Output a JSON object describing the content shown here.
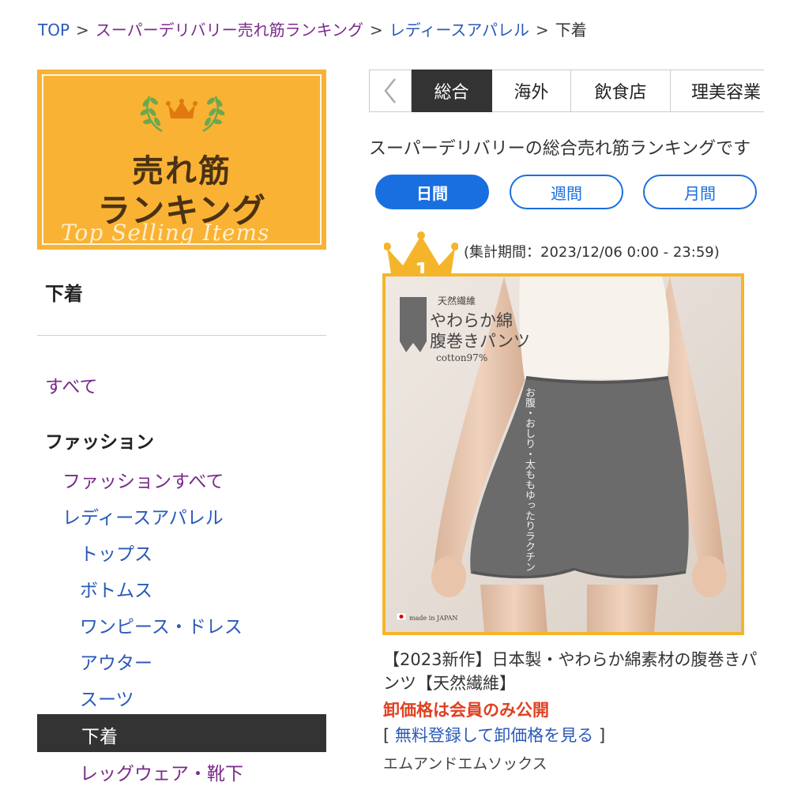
{
  "breadcrumb": {
    "top": "TOP",
    "ranking": "スーパーデリバリー売れ筋ランキング",
    "category": "レディースアパレル",
    "current": "下着",
    "separator": ">"
  },
  "banner": {
    "line1": "売れ筋",
    "line2": "ランキング",
    "subtitle": "Top Selling Items",
    "colors": {
      "background": "#f9b233",
      "crown": "#e07a10",
      "laurel": "#6aa84f"
    }
  },
  "sidebar": {
    "heading": "下着",
    "all_link": "すべて",
    "category_heading": "ファッション",
    "items": [
      {
        "label": "ファッションすべて",
        "level": 1,
        "visited": true
      },
      {
        "label": "レディースアパレル",
        "level": 1,
        "visited": false
      },
      {
        "label": "トップス",
        "level": 2,
        "visited": false
      },
      {
        "label": "ボトムス",
        "level": 2,
        "visited": false
      },
      {
        "label": "ワンピース・ドレス",
        "level": 2,
        "visited": false
      },
      {
        "label": "アウター",
        "level": 2,
        "visited": false
      },
      {
        "label": "スーツ",
        "level": 2,
        "visited": false
      },
      {
        "label": "下着",
        "level": 2,
        "active": true
      },
      {
        "label": "レッグウェア・靴下",
        "level": 2,
        "visited": true
      }
    ]
  },
  "tabs": {
    "prev_icon": "chevron-left-icon",
    "items": [
      {
        "label": "総合",
        "active": true
      },
      {
        "label": "海外",
        "active": false
      },
      {
        "label": "飲食店",
        "active": false
      },
      {
        "label": "理美容業",
        "active": false
      }
    ]
  },
  "ranking": {
    "description": "スーパーデリバリーの総合売れ筋ランキングです",
    "periods": [
      {
        "label": "日間",
        "active": true
      },
      {
        "label": "週間",
        "active": false
      },
      {
        "label": "月間",
        "active": false
      }
    ],
    "period_text": "(集計期間：2023/12/06 0:00 - 23:59)"
  },
  "product": {
    "rank": "1",
    "image_texts": {
      "natural_fiber": "天然繊維",
      "line1": "やわらか綿",
      "line2": "腹巻きパンツ",
      "cotton": "cotton97%",
      "vertical": "お腹・おしり・太ももゆったりラクチン",
      "made_in": "made in JAPAN"
    },
    "title": "【2023新作】日本製・やわらか綿素材の腹巻きパンツ【天然繊維】",
    "price_note": "卸価格は会員のみ公開",
    "register_open": "[",
    "register_link": "無料登録して卸価格を見る",
    "register_close": "]",
    "maker": "エムアンドエムソックス"
  },
  "colors": {
    "accent_blue": "#1a6fe0",
    "link_blue": "#2a5ab8",
    "visited_purple": "#7a2a8a",
    "price_red": "#e04020",
    "rank_gold": "#f5b52a"
  }
}
